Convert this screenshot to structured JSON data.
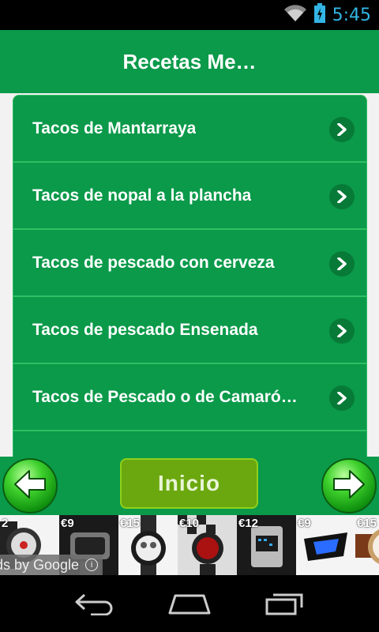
{
  "status_bar": {
    "time": "5:45"
  },
  "header": {
    "title": "Recetas Me…"
  },
  "recipes": [
    {
      "label": "Tacos de Mantarraya"
    },
    {
      "label": "Tacos de nopal a la plancha"
    },
    {
      "label": "Tacos de pescado con cerveza"
    },
    {
      "label": "Tacos de pescado Ensenada"
    },
    {
      "label": "Tacos de Pescado o de Camaró…"
    },
    {
      "label": ""
    }
  ],
  "bottom_nav": {
    "home_label": "Inicio",
    "back_icon": "arrow-left-icon",
    "forward_icon": "arrow-right-icon"
  },
  "ad": {
    "attribution": "ds by Google",
    "prices": [
      "2",
      "€9",
      "€15",
      "€10",
      "€12",
      "€9",
      "€15"
    ]
  },
  "colors": {
    "header_green": "#0a9a4a",
    "list_green": "#0a9a4a",
    "inicio_green": "#6ba80f",
    "time_blue": "#33b5e5"
  }
}
